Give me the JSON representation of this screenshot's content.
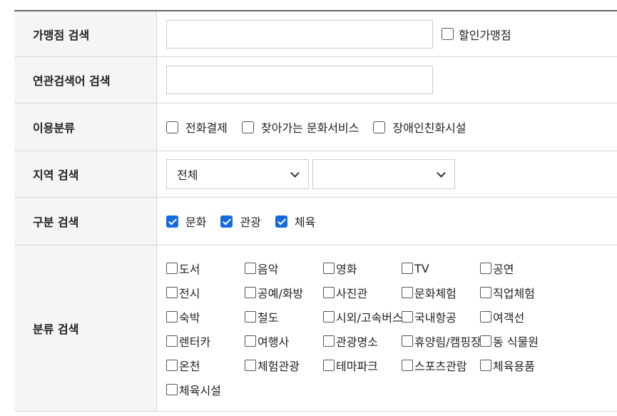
{
  "rows": {
    "store_search": {
      "label": "가맹점 검색",
      "input_value": "",
      "discount_label": "할인가맹점"
    },
    "related_search": {
      "label": "연관검색어 검색",
      "input_value": ""
    },
    "usage": {
      "label": "이용분류",
      "options": [
        "전화결제",
        "찾아가는 문화서비스",
        "장애인친화시설"
      ]
    },
    "region": {
      "label": "지역 검색",
      "select1": "전체",
      "select2": ""
    },
    "division": {
      "label": "구분 검색",
      "options": [
        "문화",
        "관광",
        "체육"
      ]
    },
    "category": {
      "label": "분류 검색",
      "items": [
        "도서",
        "음악",
        "영화",
        "TV",
        "공연",
        "전시",
        "공예/화방",
        "사진관",
        "문화체험",
        "직업체험",
        "숙박",
        "철도",
        "시외/고속버스",
        "국내항공",
        "여객선",
        "렌터카",
        "여행사",
        "관광명소",
        "휴양림/캠핑장",
        "동 식물원",
        "온천",
        "체험관광",
        "테마파크",
        "스포츠관람",
        "체육용품",
        "체육시설"
      ]
    }
  }
}
